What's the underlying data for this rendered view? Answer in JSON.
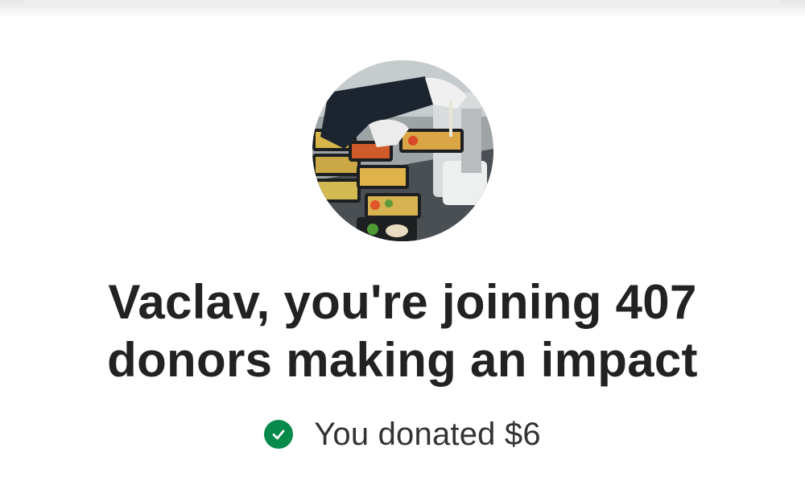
{
  "headline": {
    "line1": "Vaclav, you're joining 407",
    "line2": "donors making an impact"
  },
  "donation": {
    "text": "You donated $6",
    "icon": "check-circle-icon",
    "icon_color": "#078a4a"
  },
  "image": {
    "subject": "meal-prep-containers-photo"
  }
}
